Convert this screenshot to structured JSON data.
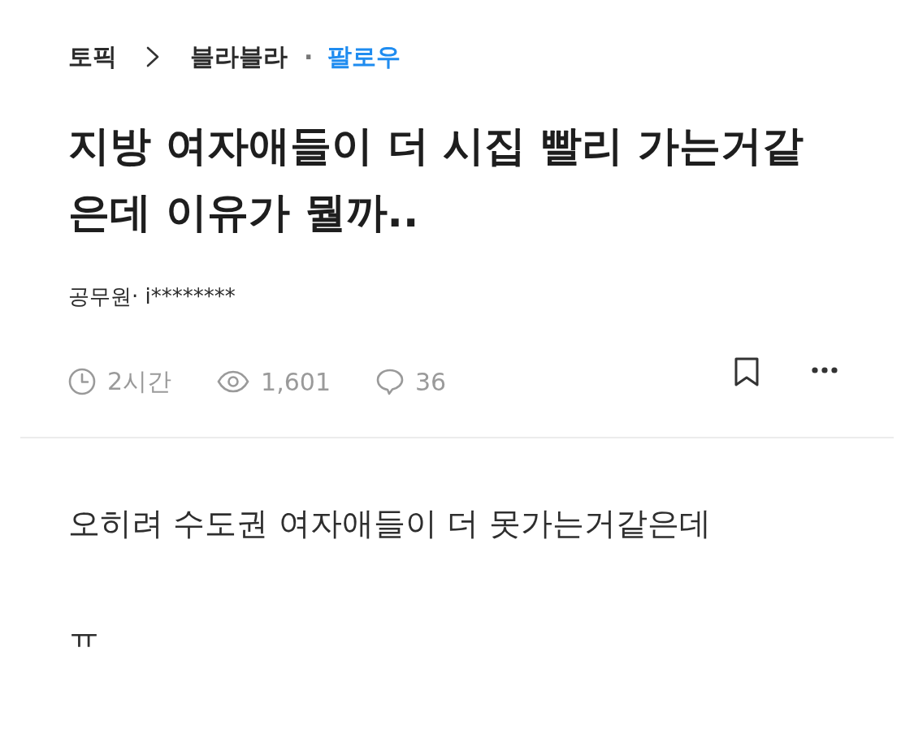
{
  "breadcrumb": {
    "topic": "토픽",
    "board": "블라블라",
    "separator": "·",
    "follow": "팔로우"
  },
  "post": {
    "title": "지방 여자애들이 더 시집 빨리 가는거같은데 이유가 뭘까..",
    "author": "공무원· i********",
    "stats": [
      {
        "kind": "time",
        "text": "2시간"
      },
      {
        "kind": "views",
        "text": "1,601"
      },
      {
        "kind": "comments",
        "text": "36"
      }
    ],
    "bookmarked": false,
    "body": [
      "오히려 수도권 여자애들이 더 못가는거같은데",
      "ㅠ"
    ]
  }
}
